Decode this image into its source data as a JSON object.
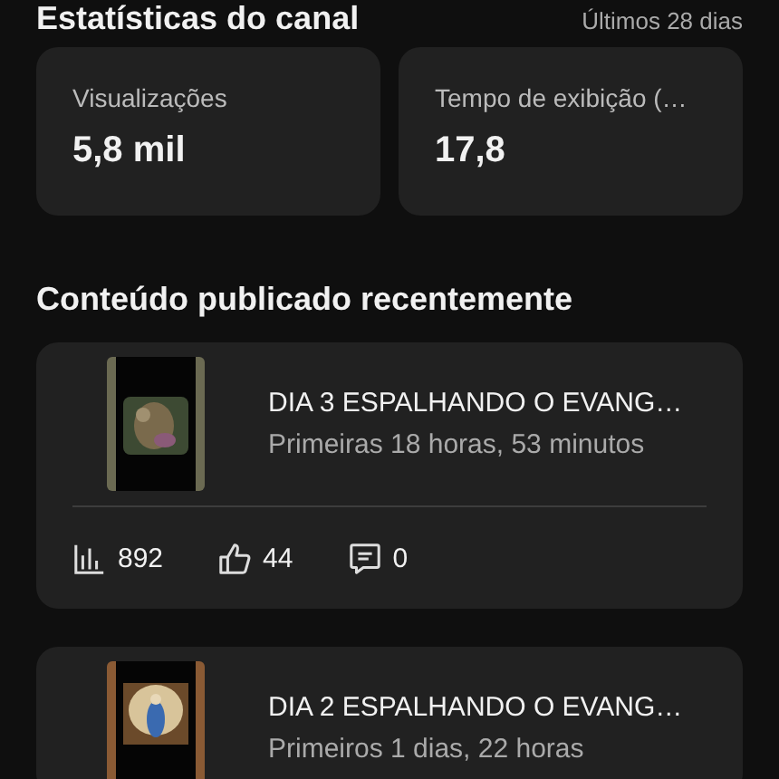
{
  "header": {
    "title": "Estatísticas do canal",
    "period": "Últimos 28 dias"
  },
  "stats": [
    {
      "label": "Visualizações",
      "value": "5,8 mil"
    },
    {
      "label": "Tempo de exibição (…",
      "value": "17,8"
    }
  ],
  "section_title": "Conteúdo publicado recentemente",
  "videos": [
    {
      "title": "DIA 3 ESPALHANDO O EVANG…",
      "subtitle": "Primeiras 18 horas, 53 minutos",
      "metrics": [
        {
          "kind": "views",
          "value": "892"
        },
        {
          "kind": "likes",
          "value": "44"
        },
        {
          "kind": "comments",
          "value": "0"
        }
      ]
    },
    {
      "title": "DIA 2 ESPALHANDO O EVANG…",
      "subtitle": "Primeiros 1 dias, 22 horas"
    }
  ]
}
